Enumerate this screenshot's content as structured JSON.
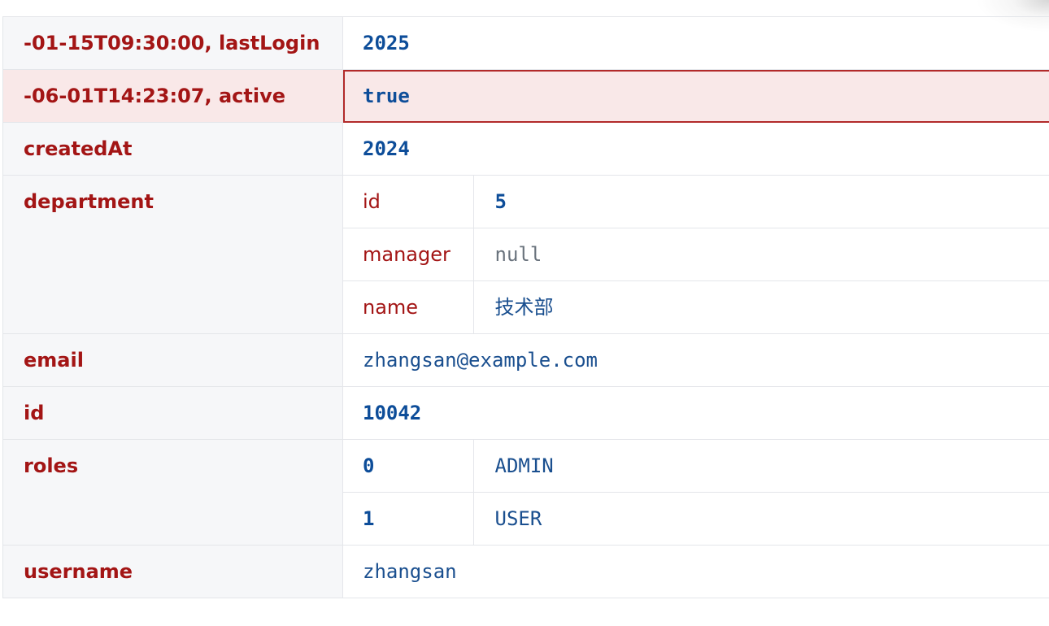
{
  "rows": [
    {
      "key": "-01-15T09:30:00, lastLogin",
      "value": "2025",
      "type": "num"
    },
    {
      "key": "-06-01T14:23:07, active",
      "value": "true",
      "type": "bool",
      "selected": true
    },
    {
      "key": "createdAt",
      "value": "2024",
      "type": "num"
    },
    {
      "key": "department",
      "children": [
        {
          "key": "id",
          "value": "5",
          "type": "num"
        },
        {
          "key": "manager",
          "value": "null",
          "type": "null"
        },
        {
          "key": "name",
          "value": "技术部",
          "type": "str"
        }
      ]
    },
    {
      "key": "email",
      "value": "zhangsan@example.com",
      "type": "str"
    },
    {
      "key": "id",
      "value": "10042",
      "type": "num"
    },
    {
      "key": "roles",
      "children": [
        {
          "key": "0",
          "value": "ADMIN",
          "type": "str"
        },
        {
          "key": "1",
          "value": "USER",
          "type": "str"
        }
      ]
    },
    {
      "key": "username",
      "value": "zhangsan",
      "type": "str"
    }
  ],
  "colors": {
    "key_text": "#a31515",
    "number_text": "#0d4d99",
    "string_text": "#1a4f8f",
    "null_text": "#6a737d",
    "key_background": "#f6f7f9",
    "selected_background": "#f9e8e8",
    "selected_border": "#b22a2a"
  }
}
